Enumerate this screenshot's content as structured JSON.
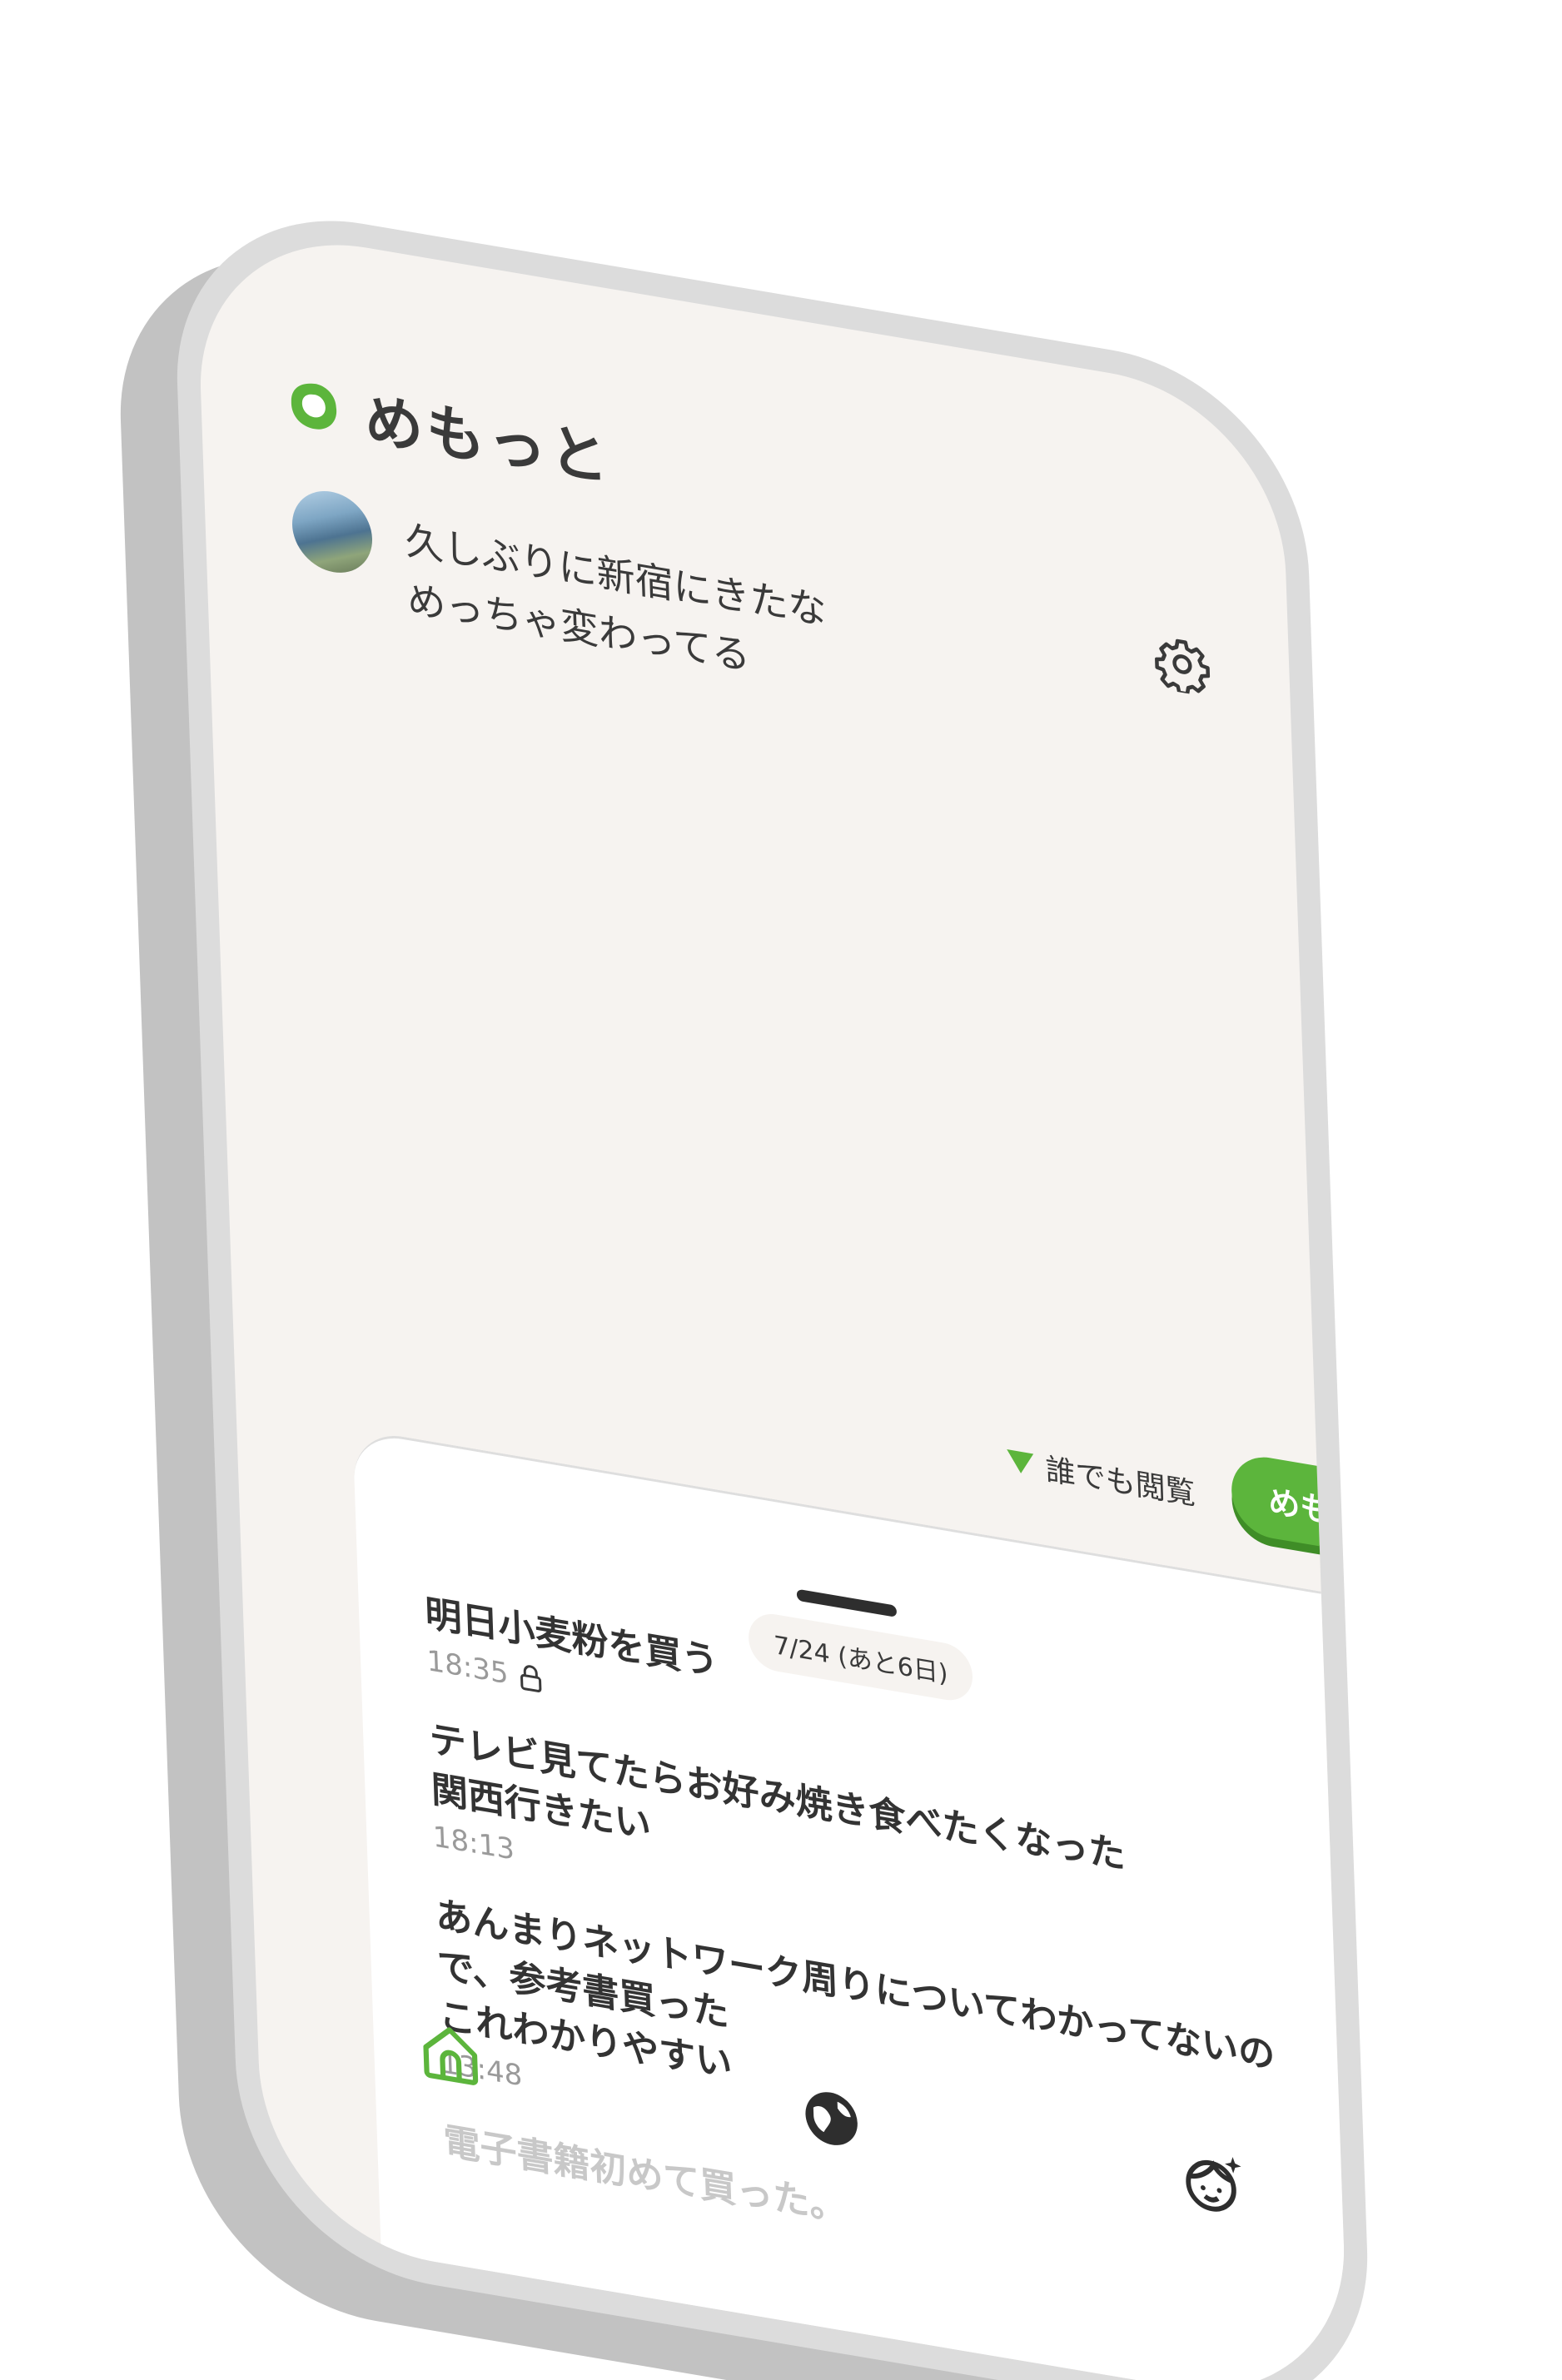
{
  "app": {
    "title": "めもっと"
  },
  "compose": {
    "text": "久しぶりに新宿にきたな\nめっちゃ変わってる",
    "visibility": "誰でも閲覧",
    "post_button": "めもする"
  },
  "timeline": {
    "date_label": "7/24 (あと6日)",
    "memos": [
      {
        "text": "明日小麦粉を買う",
        "time": "18:35",
        "locked": true
      },
      {
        "text": "テレビ見てたらお好み焼き食べたくなった\n関西行きたい",
        "time": "18:13",
        "locked": false
      },
      {
        "text": "あんまりネットワーク周りについてわかってないの\nで、参考書買った\nこれわかりやすい",
        "time": "13:48",
        "locked": false
      },
      {
        "text": "電子書籍初めて買った。",
        "time": "",
        "locked": false
      }
    ]
  },
  "nav": {
    "items": [
      {
        "icon": "home-icon",
        "active": true
      },
      {
        "icon": "globe-icon",
        "active": false
      },
      {
        "icon": "profile-icon",
        "active": false
      }
    ]
  },
  "colors": {
    "accent": "#5cb53c",
    "accent_dark": "#3f8d27",
    "background": "#f6f3f0",
    "text": "#3a3a3a",
    "muted": "#9a9a9a"
  }
}
